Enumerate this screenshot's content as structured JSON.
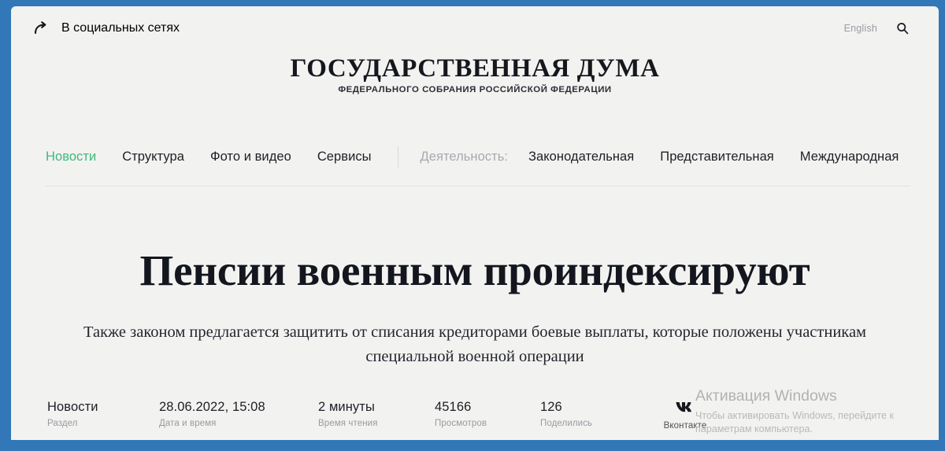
{
  "topbar": {
    "share_icon": "share-arrow-icon",
    "share_label": "В социальных сетях",
    "language_label": "English",
    "search_icon": "search-icon"
  },
  "masthead": {
    "title": "ГОСУДАРСТВЕННАЯ ДУМА",
    "subtitle": "ФЕДЕРАЛЬНОГО СОБРАНИЯ РОССИЙСКОЙ ФЕДЕРАЦИИ"
  },
  "nav": {
    "items": [
      {
        "label": "Новости",
        "state": "active"
      },
      {
        "label": "Структура",
        "state": "default"
      },
      {
        "label": "Фото и видео",
        "state": "default"
      },
      {
        "label": "Сервисы",
        "state": "default"
      }
    ],
    "activity_label": "Деятельность:",
    "activity_items": [
      {
        "label": "Законодательная"
      },
      {
        "label": "Представительная"
      },
      {
        "label": "Международная"
      }
    ]
  },
  "article": {
    "headline": "Пенсии военным проиндексируют",
    "lead": "Также законом предлагается защитить от списания кредиторами боевые выплаты, которые положены участникам специальной военной операции"
  },
  "meta": {
    "section_value": "Новости",
    "section_label": "Раздел",
    "datetime_value": "28.06.2022, 15:08",
    "datetime_label": "Дата и время",
    "reading_value": "2 минуты",
    "reading_label": "Время чтения",
    "views_value": "45166",
    "views_label": "Просмотров",
    "shares_value": "126",
    "shares_label": "Поделились",
    "social_icon": "vk-icon",
    "social_label": "Вконтакте"
  },
  "watermark": {
    "title": "Активация Windows",
    "subtitle": "Чтобы активировать Windows, перейдите к параметрам компьютера."
  },
  "colors": {
    "frame_blue": "#3277b8",
    "page_background": "#f2f2f0",
    "accent_green": "#3cba7c",
    "text_dark": "#15171d",
    "text_muted": "#9a9aa2"
  }
}
